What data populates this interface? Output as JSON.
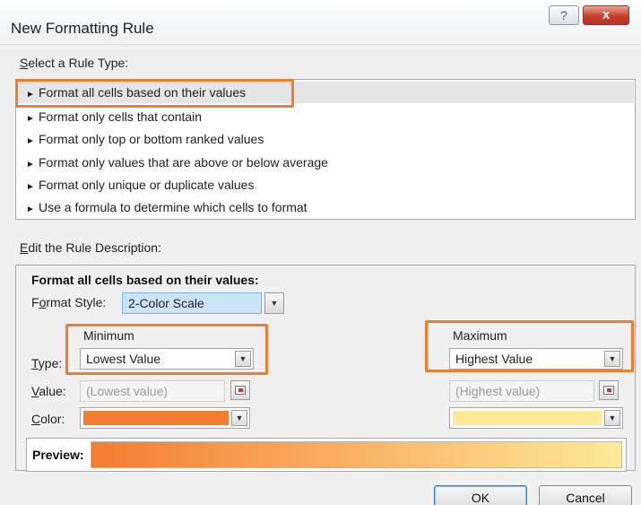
{
  "window": {
    "title": "New Formatting Rule",
    "help_glyph": "?",
    "close_glyph": "x"
  },
  "rule_type": {
    "label_accel": "S",
    "label_rest": "elect a Rule Type:",
    "items": [
      {
        "label": "Format all cells based on their values",
        "selected": true
      },
      {
        "label": "Format only cells that contain",
        "selected": false
      },
      {
        "label": "Format only top or bottom ranked values",
        "selected": false
      },
      {
        "label": "Format only values that are above or below average",
        "selected": false
      },
      {
        "label": "Format only unique or duplicate values",
        "selected": false
      },
      {
        "label": "Use a formula to determine which cells to format",
        "selected": false
      }
    ],
    "arrow_glyph": "►"
  },
  "description": {
    "label_accel": "E",
    "label_rest": "dit the Rule Description:",
    "heading": "Format all cells based on their values:",
    "format_style_pre": "F",
    "format_style_accel": "o",
    "format_style_post": "rmat Style:",
    "format_style_value": "2-Color Scale",
    "minimum_header": "Minimum",
    "maximum_header": "Maximum",
    "type_accel": "T",
    "type_rest": "ype:",
    "value_accel": "V",
    "value_rest": "alue:",
    "color_accel": "C",
    "color_rest": "olor:",
    "min_type": "Lowest Value",
    "max_type": "Highest Value",
    "min_value_placeholder": "(Lowest value)",
    "max_value_placeholder": "(Highest value)",
    "min_color": "#f47c30",
    "max_color": "#ffe99a",
    "preview_label": "Preview:",
    "dropdown_glyph": "▼"
  },
  "buttons": {
    "ok": "OK",
    "cancel": "Cancel"
  },
  "colors": {
    "highlight": "#ec7d31",
    "selection": "#e5e5e5",
    "style_selected": "#cce4f7"
  }
}
